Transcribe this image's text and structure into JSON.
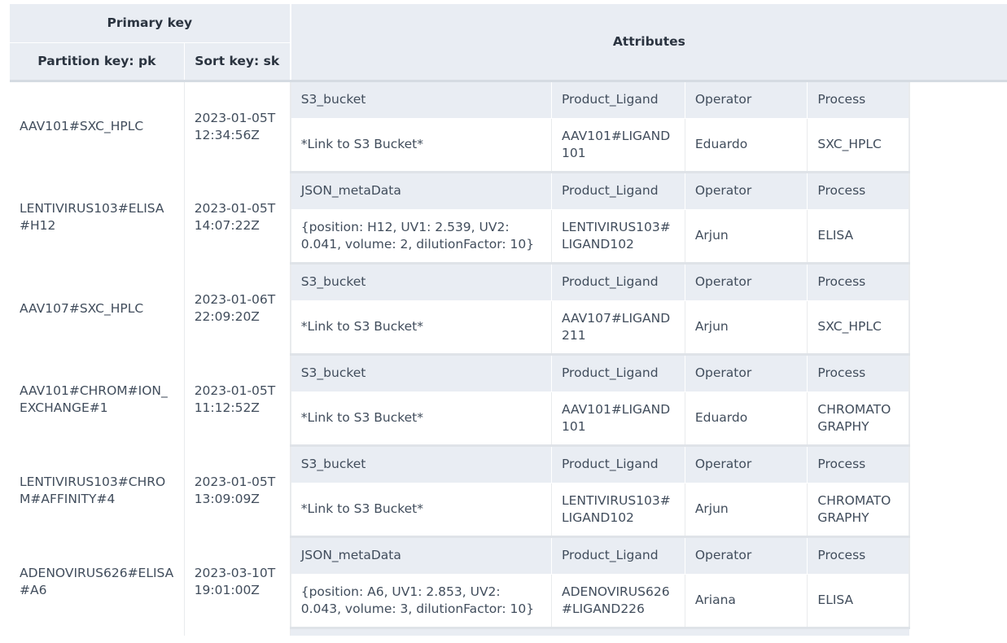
{
  "headers": {
    "primary_key": "Primary key",
    "partition_key": "Partition key: pk",
    "sort_key": "Sort key: sk",
    "attributes": "Attributes"
  },
  "items": [
    {
      "pk": "AAV101#SXC_HPLC",
      "sk": "2023-01-05T12:34:56Z",
      "attr_names": [
        "S3_bucket",
        "Product_Ligand",
        "Operator",
        "Process"
      ],
      "attr_values": [
        "*Link to S3 Bucket*",
        "AAV101#LIGAND101",
        "Eduardo",
        "SXC_HPLC"
      ]
    },
    {
      "pk": "LENTIVIRUS103#ELISA#H12",
      "sk": "2023-01-05T14:07:22Z",
      "attr_names": [
        "JSON_metaData",
        "Product_Ligand",
        "Operator",
        "Process"
      ],
      "attr_values": [
        "{position: H12, UV1: 2.539, UV2: 0.041, volume: 2, dilutionFactor: 10}",
        "LENTIVIRUS103#LIGAND102",
        "Arjun",
        "ELISA"
      ]
    },
    {
      "pk": "AAV107#SXC_HPLC",
      "sk": "2023-01-06T22:09:20Z",
      "attr_names": [
        "S3_bucket",
        "Product_Ligand",
        "Operator",
        "Process"
      ],
      "attr_values": [
        "*Link to S3 Bucket*",
        "AAV107#LIGAND211",
        "Arjun",
        "SXC_HPLC"
      ]
    },
    {
      "pk": "AAV101#CHROM#ION_EXCHANGE#1",
      "sk": "2023-01-05T11:12:52Z",
      "attr_names": [
        "S3_bucket",
        "Product_Ligand",
        "Operator",
        "Process"
      ],
      "attr_values": [
        "*Link to S3 Bucket*",
        "AAV101#LIGAND101",
        "Eduardo",
        "CHROMATOGRAPHY"
      ]
    },
    {
      "pk": "LENTIVIRUS103#CHROM#AFFINITY#4",
      "sk": "2023-01-05T13:09:09Z",
      "attr_names": [
        "S3_bucket",
        "Product_Ligand",
        "Operator",
        "Process"
      ],
      "attr_values": [
        "*Link to S3 Bucket*",
        "LENTIVIRUS103#LIGAND102",
        "Arjun",
        "CHROMATOGRAPHY"
      ]
    },
    {
      "pk": "ADENOVIRUS626#ELISA#A6",
      "sk": "2023-03-10T19:01:00Z",
      "attr_names": [
        "JSON_metaData",
        "Product_Ligand",
        "Operator",
        "Process"
      ],
      "attr_values": [
        "{position: A6, UV1: 2.853, UV2: 0.043, volume: 3, dilutionFactor: 10}",
        "ADENOVIRUS626#LIGAND226",
        "Ariana",
        "ELISA"
      ]
    }
  ],
  "colors": {
    "header_bg": "#e9edf3",
    "cell_bg": "#ffffff",
    "text": "#414d5c",
    "header_text": "#2b3440"
  }
}
